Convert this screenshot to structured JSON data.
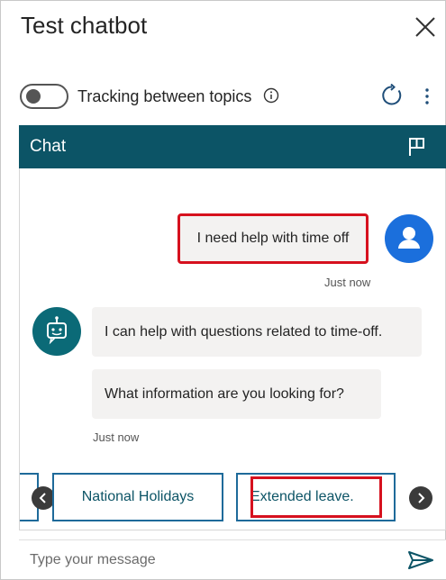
{
  "header": {
    "title": "Test chatbot",
    "close_icon": "close-icon"
  },
  "toolbar": {
    "tracking_label": "Tracking between topics",
    "tracking_enabled": false,
    "info_icon": "info-icon",
    "refresh_icon": "refresh-icon",
    "more_icon": "more-vertical-icon"
  },
  "chat": {
    "title": "Chat",
    "flag_icon": "flag-icon",
    "accent_color": "#0c5466",
    "messages": [
      {
        "from": "user",
        "text": "I need help with time off",
        "time": "Just now"
      },
      {
        "from": "bot",
        "text": "I can help with questions related to time-off."
      },
      {
        "from": "bot",
        "text": "What information are you looking for?",
        "time": "Just now"
      }
    ],
    "suggestions": [
      "National Holidays",
      "Extended leave."
    ],
    "highlight_color": "#d6111e"
  },
  "composer": {
    "placeholder": "Type your message",
    "send_icon": "send-icon"
  }
}
